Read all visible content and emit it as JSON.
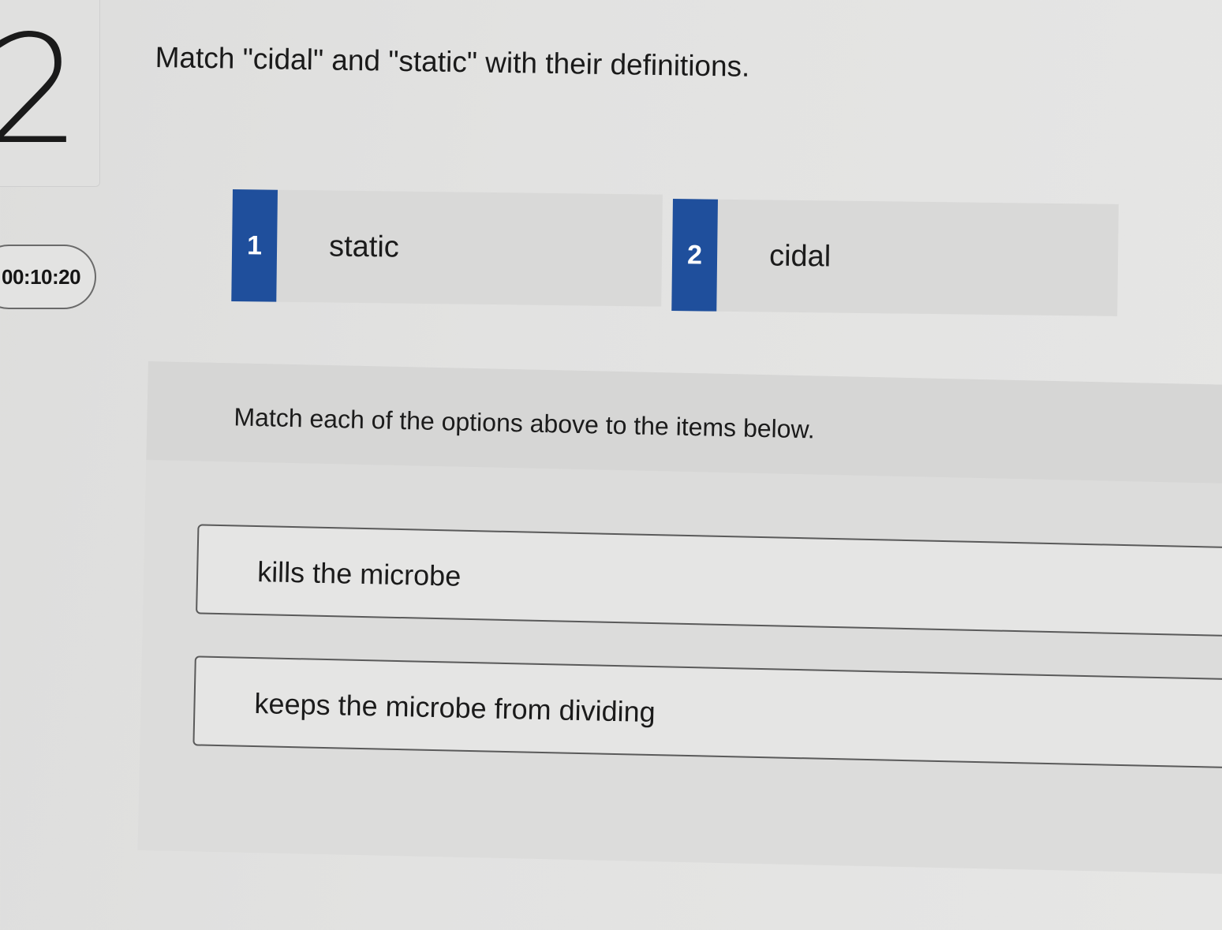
{
  "question": {
    "number": "2",
    "timer": "00:10:20",
    "title": "Match \"cidal\" and \"static\" with their definitions."
  },
  "options": [
    {
      "number": "1",
      "label": "static"
    },
    {
      "number": "2",
      "label": "cidal"
    }
  ],
  "matching": {
    "instructions": "Match each of the options above to the items below.",
    "items": [
      {
        "text": "kills the microbe"
      },
      {
        "text": "keeps the microbe from dividing"
      }
    ]
  },
  "colors": {
    "badge": "#1f4f9c",
    "background": "#e2e2e1"
  }
}
